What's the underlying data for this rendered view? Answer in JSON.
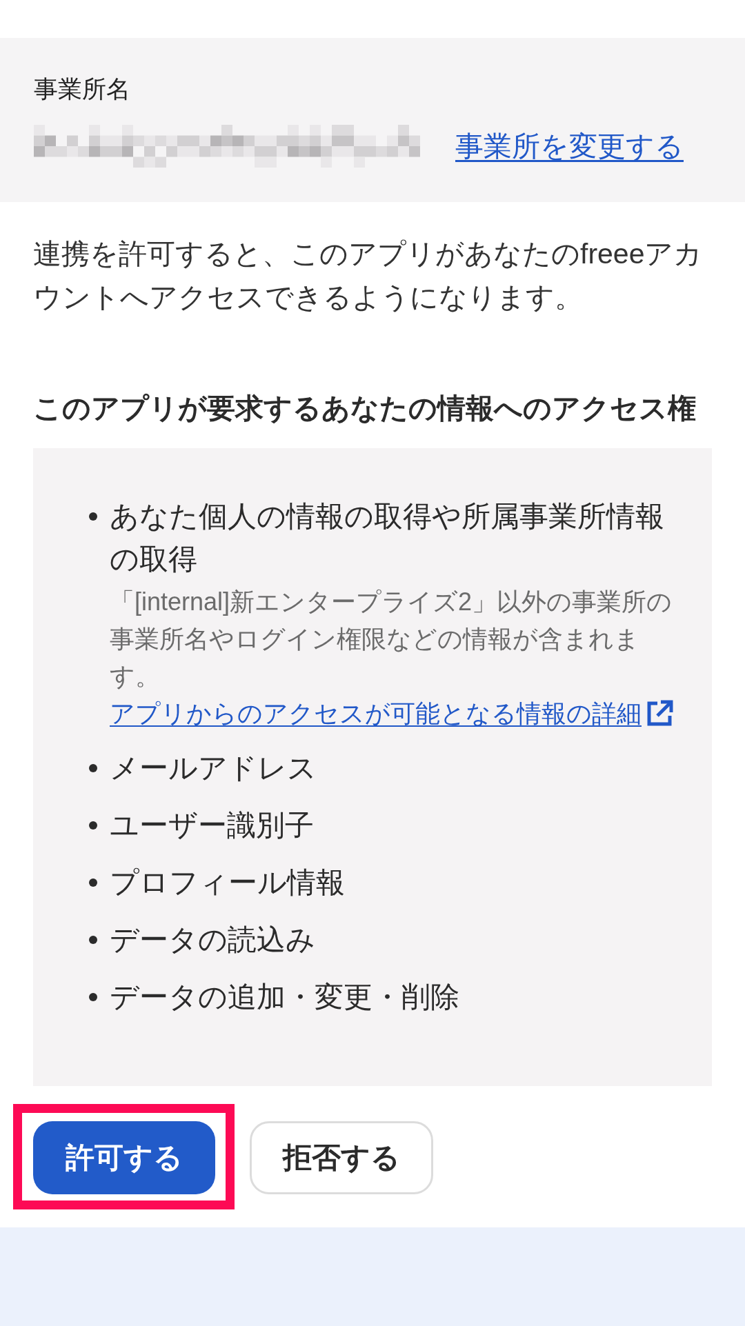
{
  "office": {
    "label": "事業所名",
    "change_link": "事業所を変更する"
  },
  "intro": "連携を許可すると、このアプリがあなたのfreeeアカウントへアクセスできるようになります。",
  "permissions": {
    "heading": "このアプリが要求するあなたの情報へのアクセス権",
    "items": [
      {
        "text": "あなた個人の情報の取得や所属事業所情報の取得",
        "note": "「[internal]新エンタープライズ2」以外の事業所の事業所名やログイン権限などの情報が含まれます。",
        "link": "アプリからのアクセスが可能となる情報の詳細"
      },
      {
        "text": "メールアドレス"
      },
      {
        "text": "ユーザー識別子"
      },
      {
        "text": "プロフィール情報"
      },
      {
        "text": "データの読込み"
      },
      {
        "text": "データの追加・変更・削除"
      }
    ]
  },
  "buttons": [
    {
      "label": "許可する",
      "kind": "primary",
      "highlighted": true
    },
    {
      "label": "拒否する",
      "kind": "secondary",
      "highlighted": false
    }
  ]
}
